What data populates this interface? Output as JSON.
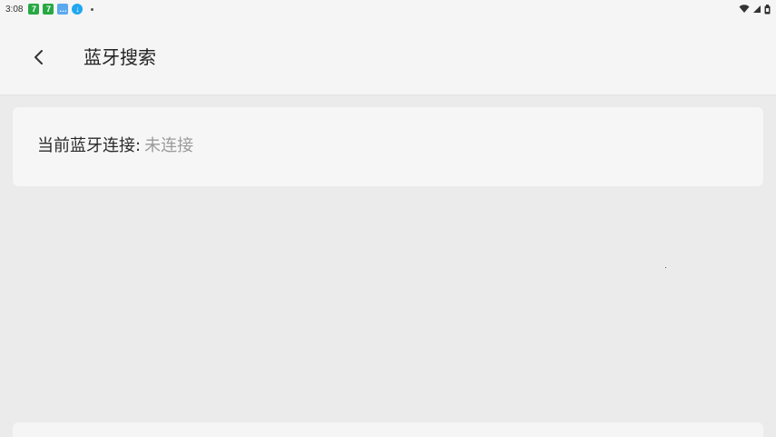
{
  "status_bar": {
    "time": "3:08",
    "notifications": [
      {
        "icon": "app-7-icon",
        "glyph": "7"
      },
      {
        "icon": "app-7-icon",
        "glyph": "7"
      },
      {
        "icon": "chat-app-icon",
        "glyph": "…"
      },
      {
        "icon": "download-icon",
        "glyph": "↓"
      }
    ],
    "system_icons": [
      "wifi-icon",
      "cellular-signal-icon",
      "battery-icon"
    ]
  },
  "app_bar": {
    "title": "蓝牙搜索",
    "back_icon": "chevron-left-icon"
  },
  "connection": {
    "label": "当前蓝牙连接:",
    "value": "未连接"
  },
  "colors": {
    "background": "#ebebeb",
    "surface": "#f5f5f5",
    "text_primary": "#222222",
    "text_secondary": "#9b9b9b",
    "notif_green": "#27a844",
    "notif_blue": "#20a7f0"
  }
}
